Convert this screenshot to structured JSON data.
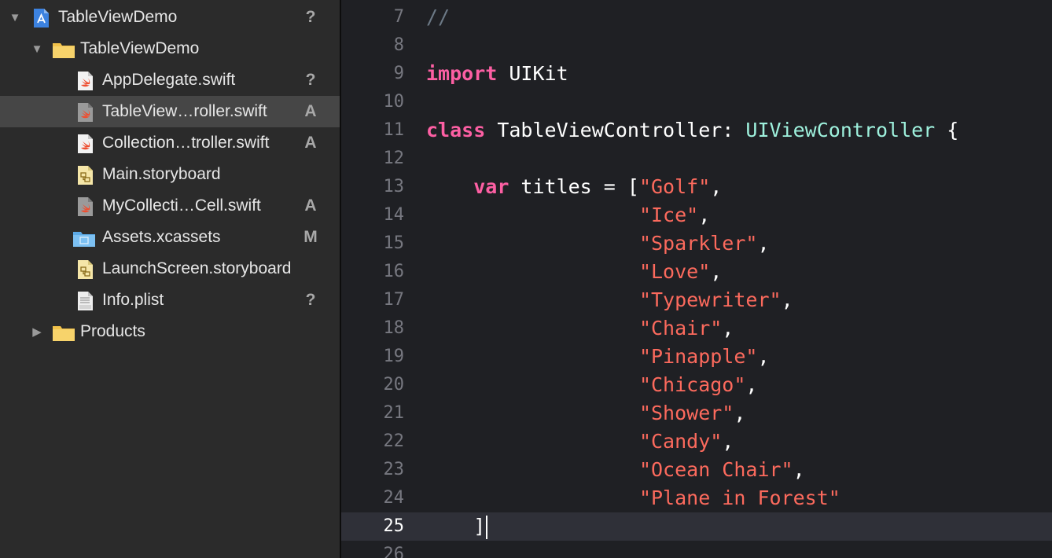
{
  "colors": {
    "navigator_bg": "#2b2b2b",
    "selected_row_bg": "#464646",
    "editor_bg": "#1f2024",
    "current_line_bg": "#2f3038",
    "keyword": "#fc5fa3",
    "type": "#9ef1dd",
    "string": "#fc6a5d",
    "comment": "#6c7986",
    "plain": "#ffffff",
    "line_number": "#777880"
  },
  "navigator": {
    "items": [
      {
        "label": "TableViewDemo",
        "icon": "xcode-project-icon",
        "disclosure": "expanded",
        "badge": "?"
      },
      {
        "label": "TableViewDemo",
        "icon": "folder-icon",
        "disclosure": "expanded",
        "badge": ""
      },
      {
        "label": "AppDelegate.swift",
        "icon": "swift-file-icon",
        "badge": "?"
      },
      {
        "label": "TableView…roller.swift",
        "icon": "swift-file-icon",
        "badge": "A",
        "selected": true
      },
      {
        "label": "Collection…troller.swift",
        "icon": "swift-file-icon",
        "badge": "A"
      },
      {
        "label": "Main.storyboard",
        "icon": "storyboard-file-icon",
        "badge": ""
      },
      {
        "label": "MyCollecti…Cell.swift",
        "icon": "swift-file-icon",
        "badge": "A"
      },
      {
        "label": "Assets.xcassets",
        "icon": "asset-catalog-icon",
        "badge": "M"
      },
      {
        "label": "LaunchScreen.storyboard",
        "icon": "storyboard-file-icon",
        "badge": ""
      },
      {
        "label": "Info.plist",
        "icon": "plist-file-icon",
        "badge": "?"
      },
      {
        "label": "Products",
        "icon": "folder-icon",
        "disclosure": "collapsed",
        "badge": ""
      }
    ]
  },
  "editor": {
    "current_line": "25",
    "lines": [
      {
        "number": "7",
        "tokens": [
          {
            "t": "//",
            "k": "comment"
          }
        ]
      },
      {
        "number": "8",
        "tokens": []
      },
      {
        "number": "9",
        "tokens": [
          {
            "t": "import",
            "k": "keyword"
          },
          {
            "t": " UIKit",
            "k": "plain"
          }
        ]
      },
      {
        "number": "10",
        "tokens": []
      },
      {
        "number": "11",
        "tokens": [
          {
            "t": "class",
            "k": "keyword"
          },
          {
            "t": " TableViewController: ",
            "k": "plain"
          },
          {
            "t": "UIViewController",
            "k": "type"
          },
          {
            "t": " {",
            "k": "plain"
          }
        ]
      },
      {
        "number": "12",
        "tokens": []
      },
      {
        "number": "13",
        "tokens": [
          {
            "t": "    ",
            "k": "plain"
          },
          {
            "t": "var",
            "k": "keyword"
          },
          {
            "t": " titles = [",
            "k": "plain"
          },
          {
            "t": "\"Golf\"",
            "k": "string"
          },
          {
            "t": ",",
            "k": "plain"
          }
        ]
      },
      {
        "number": "14",
        "tokens": [
          {
            "t": "                  ",
            "k": "plain"
          },
          {
            "t": "\"Ice\"",
            "k": "string"
          },
          {
            "t": ",",
            "k": "plain"
          }
        ]
      },
      {
        "number": "15",
        "tokens": [
          {
            "t": "                  ",
            "k": "plain"
          },
          {
            "t": "\"Sparkler\"",
            "k": "string"
          },
          {
            "t": ",",
            "k": "plain"
          }
        ]
      },
      {
        "number": "16",
        "tokens": [
          {
            "t": "                  ",
            "k": "plain"
          },
          {
            "t": "\"Love\"",
            "k": "string"
          },
          {
            "t": ",",
            "k": "plain"
          }
        ]
      },
      {
        "number": "17",
        "tokens": [
          {
            "t": "                  ",
            "k": "plain"
          },
          {
            "t": "\"Typewriter\"",
            "k": "string"
          },
          {
            "t": ",",
            "k": "plain"
          }
        ]
      },
      {
        "number": "18",
        "tokens": [
          {
            "t": "                  ",
            "k": "plain"
          },
          {
            "t": "\"Chair\"",
            "k": "string"
          },
          {
            "t": ",",
            "k": "plain"
          }
        ]
      },
      {
        "number": "19",
        "tokens": [
          {
            "t": "                  ",
            "k": "plain"
          },
          {
            "t": "\"Pinapple\"",
            "k": "string"
          },
          {
            "t": ",",
            "k": "plain"
          }
        ]
      },
      {
        "number": "20",
        "tokens": [
          {
            "t": "                  ",
            "k": "plain"
          },
          {
            "t": "\"Chicago\"",
            "k": "string"
          },
          {
            "t": ",",
            "k": "plain"
          }
        ]
      },
      {
        "number": "21",
        "tokens": [
          {
            "t": "                  ",
            "k": "plain"
          },
          {
            "t": "\"Shower\"",
            "k": "string"
          },
          {
            "t": ",",
            "k": "plain"
          }
        ]
      },
      {
        "number": "22",
        "tokens": [
          {
            "t": "                  ",
            "k": "plain"
          },
          {
            "t": "\"Candy\"",
            "k": "string"
          },
          {
            "t": ",",
            "k": "plain"
          }
        ]
      },
      {
        "number": "23",
        "tokens": [
          {
            "t": "                  ",
            "k": "plain"
          },
          {
            "t": "\"Ocean Chair\"",
            "k": "string"
          },
          {
            "t": ",",
            "k": "plain"
          }
        ]
      },
      {
        "number": "24",
        "tokens": [
          {
            "t": "                  ",
            "k": "plain"
          },
          {
            "t": "\"Plane in Forest\"",
            "k": "string"
          }
        ]
      },
      {
        "number": "25",
        "tokens": [
          {
            "t": "    ]",
            "k": "plain"
          }
        ]
      },
      {
        "number": "26",
        "tokens": []
      }
    ]
  }
}
